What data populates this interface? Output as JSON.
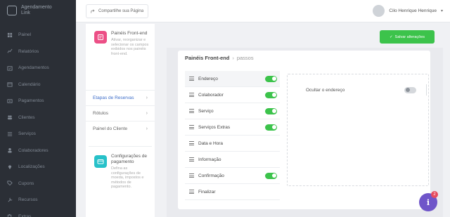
{
  "brand": {
    "line1": "Agendamento",
    "line2": "Link"
  },
  "sidebar": {
    "items": [
      {
        "label": "Painel",
        "icon": "grid-icon"
      },
      {
        "label": "Relatórios",
        "icon": "chart-line-icon"
      },
      {
        "label": "Agendamentos",
        "icon": "calendar-check-icon"
      },
      {
        "label": "Calendário",
        "icon": "calendar-icon"
      },
      {
        "label": "Pagamentos",
        "icon": "money-icon"
      },
      {
        "label": "Clientes",
        "icon": "users-icon"
      },
      {
        "label": "Serviços",
        "icon": "list-icon"
      },
      {
        "label": "Colaboradores",
        "icon": "user-icon"
      },
      {
        "label": "Localizações",
        "icon": "location-icon"
      },
      {
        "label": "Cupons",
        "icon": "tag-icon"
      },
      {
        "label": "Recursos",
        "icon": "tool-icon"
      },
      {
        "label": "Extras",
        "icon": "puzzle-icon"
      }
    ]
  },
  "topbar": {
    "share_label": "Compartilhe sua Página",
    "user_name": "Cilo Henrique Henrique"
  },
  "left": {
    "card1_title": "Painéis Front-end",
    "card1_desc": "Ativar, reorganizar e selecionar os campos exibidos nos painéis front-end.",
    "menu": [
      {
        "label": "Etapas de Reservas",
        "active": true
      },
      {
        "label": "Rótulos",
        "active": false
      },
      {
        "label": "Painel do Cliente",
        "active": false
      }
    ],
    "card2_title": "Configurações de pagamento",
    "card2_desc": "Defina as configurações de moeda, impostos e métodos de pagamento."
  },
  "save_label": "Salvar alterações",
  "panel": {
    "title": "Painéis Front-end",
    "separator": "›",
    "subtitle": "passos",
    "steps": [
      {
        "label": "Endereço",
        "toggle": true
      },
      {
        "label": "Colaborador",
        "toggle": true
      },
      {
        "label": "Serviço",
        "toggle": true
      },
      {
        "label": "Serviços Extras",
        "toggle": true
      },
      {
        "label": "Data e Hora",
        "toggle": null
      },
      {
        "label": "Informação",
        "toggle": null
      },
      {
        "label": "Confirmação",
        "toggle": true
      },
      {
        "label": "Finalizar",
        "toggle": null
      }
    ],
    "option_label": "Ocultar o endereço",
    "option_on": false
  },
  "help": {
    "icon": "i",
    "badge": "2"
  },
  "colors": {
    "accent_green": "#3cc34b",
    "sidebar_bg": "#2b2f36",
    "help_purple": "#6f55c9",
    "pink": "#ec4f86",
    "teal": "#27c1c9"
  }
}
